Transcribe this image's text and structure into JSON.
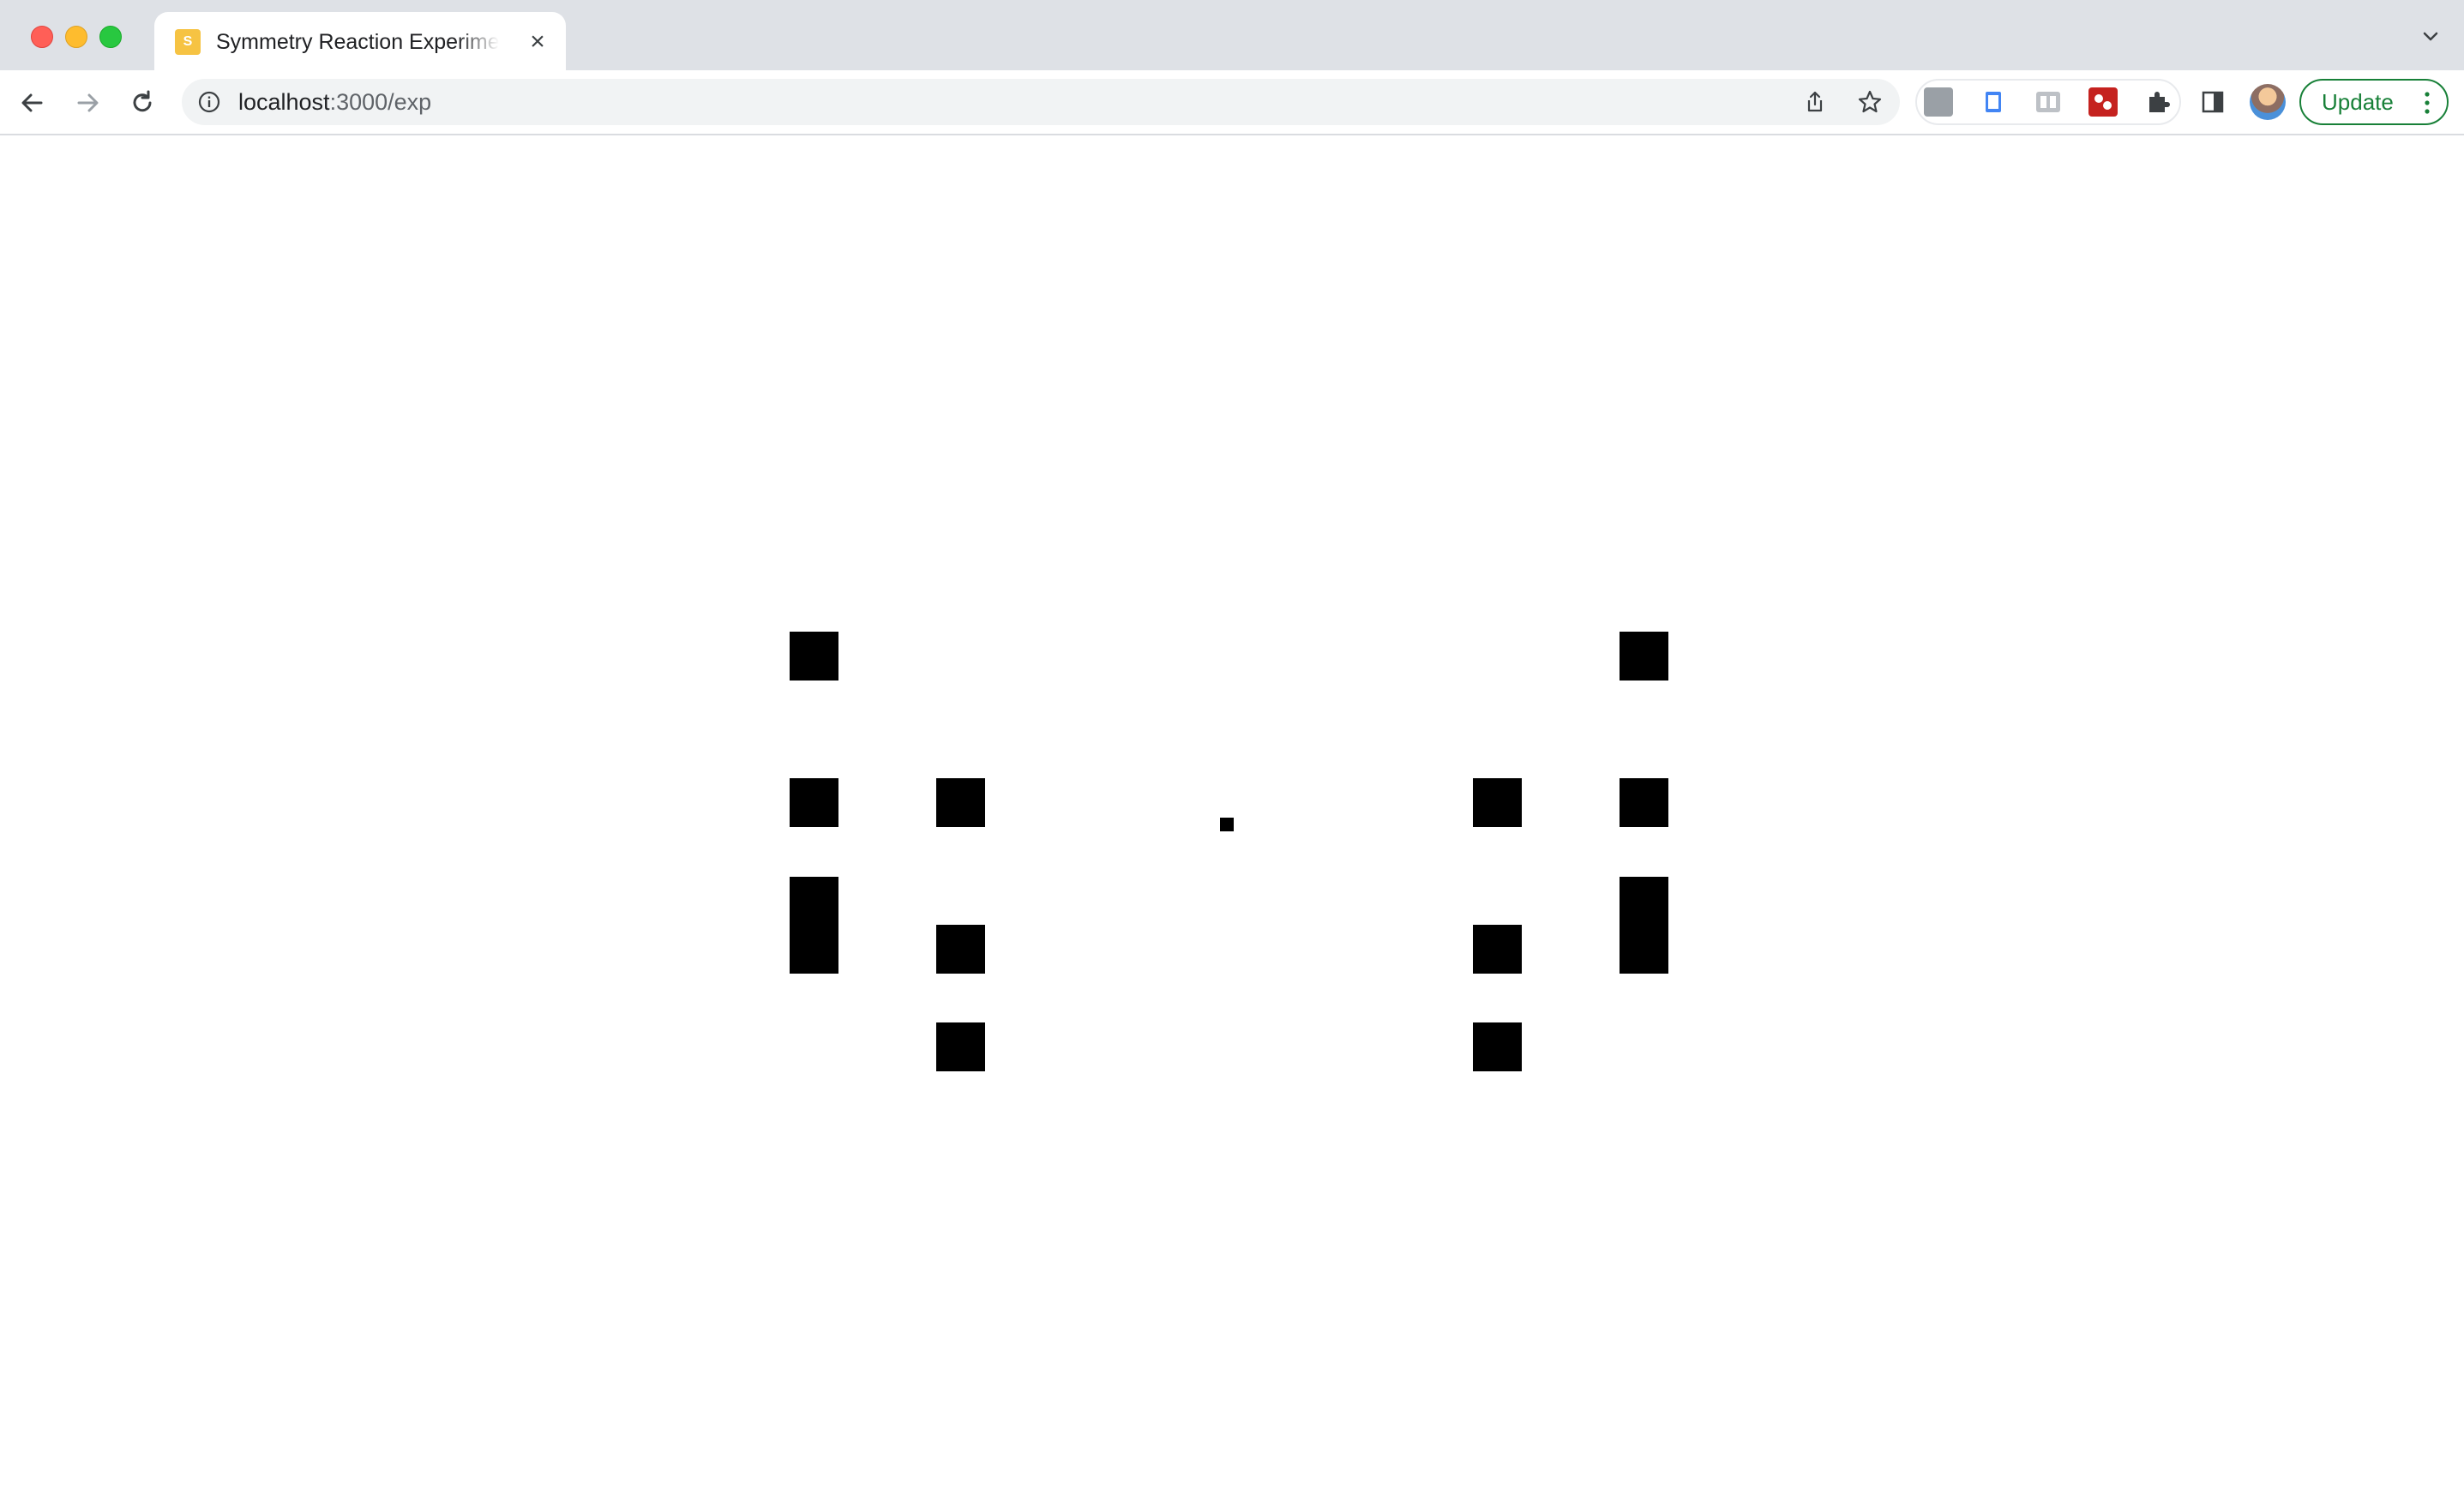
{
  "browser": {
    "tab": {
      "title": "Symmetry Reaction Experiment",
      "favicon_text": "S",
      "favicon_color": "#f6c343"
    },
    "address": {
      "host": "localhost",
      "path": ":3000/exp"
    },
    "update_label": "Update",
    "accent_color": "#188038",
    "icons": [
      "back-icon",
      "forward-icon",
      "reload-icon",
      "info-icon",
      "share-icon",
      "star-icon",
      "puzzle-icon",
      "side-panel-icon",
      "kebab-menu-icon",
      "tab-list-chevron-icon",
      "close-icon"
    ]
  },
  "stimulus": {
    "fixation": "small center square",
    "element_color": "#000000",
    "background_color": "#ffffff"
  }
}
